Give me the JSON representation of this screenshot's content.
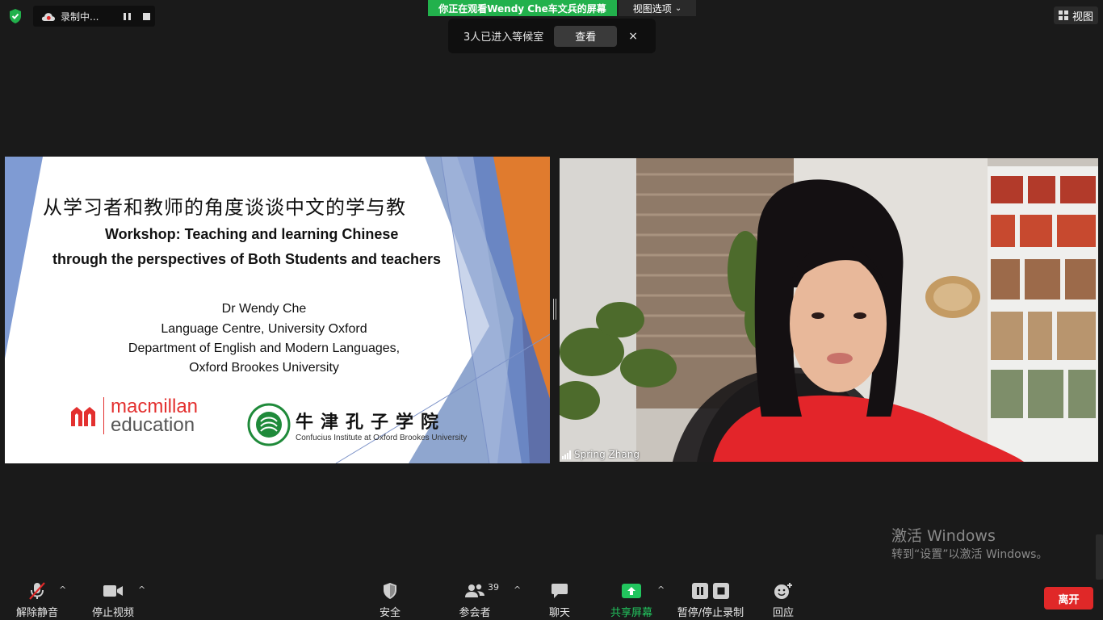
{
  "top": {
    "recording_label": "录制中...",
    "viewing_banner": "你正在观看Wendy Che车文兵的屏幕",
    "view_options": "视图选项",
    "view_options_caret": "⌄",
    "waiting_message": "3人已进入等候室",
    "waiting_view_button": "查看",
    "waiting_close": "×",
    "view_button": "视图"
  },
  "slide": {
    "title_cn": "从学习者和教师的角度谈谈中文的学与教",
    "workshop_line1": "Workshop: Teaching and learning Chinese",
    "workshop_line2": "through the perspectives of Both Students and teachers",
    "presenter": "Dr Wendy Che",
    "affiliation1": "Language Centre, University Oxford",
    "affiliation2": "Department of English and Modern Languages,",
    "affiliation3": "Oxford Brookes University",
    "logo_macmillan_1": "macmillan",
    "logo_macmillan_2": "education",
    "logo_confucius_cn": "牛津孔子学院",
    "logo_confucius_en": "Confucius Institute at Oxford Brookes University"
  },
  "video": {
    "participant_name": "Spring Zhang"
  },
  "watermark": {
    "line1": "激活 Windows",
    "line2": "转到“设置”以激活 Windows。"
  },
  "toolbar": {
    "unmute": "解除静音",
    "stop_video": "停止视频",
    "security": "安全",
    "participants": "参会者",
    "participants_count": "39",
    "chat": "聊天",
    "share_screen": "共享屏幕",
    "pause_stop_recording": "暂停/停止录制",
    "reactions": "回应",
    "leave": "离开",
    "caret": "^"
  },
  "colors": {
    "accent_green": "#22b14c",
    "leave_red": "#e02828",
    "macmillan_red": "#e3302f",
    "confucius_green": "#1f8a3a"
  },
  "icons": [
    "shield-check-icon",
    "cloud-record-icon",
    "pause-icon",
    "stop-icon",
    "grid-icon",
    "microphone-muted-icon",
    "video-camera-icon",
    "security-shield-icon",
    "participants-icon",
    "chat-bubble-icon",
    "share-screen-icon",
    "pause-stop-recording-icon",
    "reaction-icon",
    "signal-bars-icon"
  ]
}
